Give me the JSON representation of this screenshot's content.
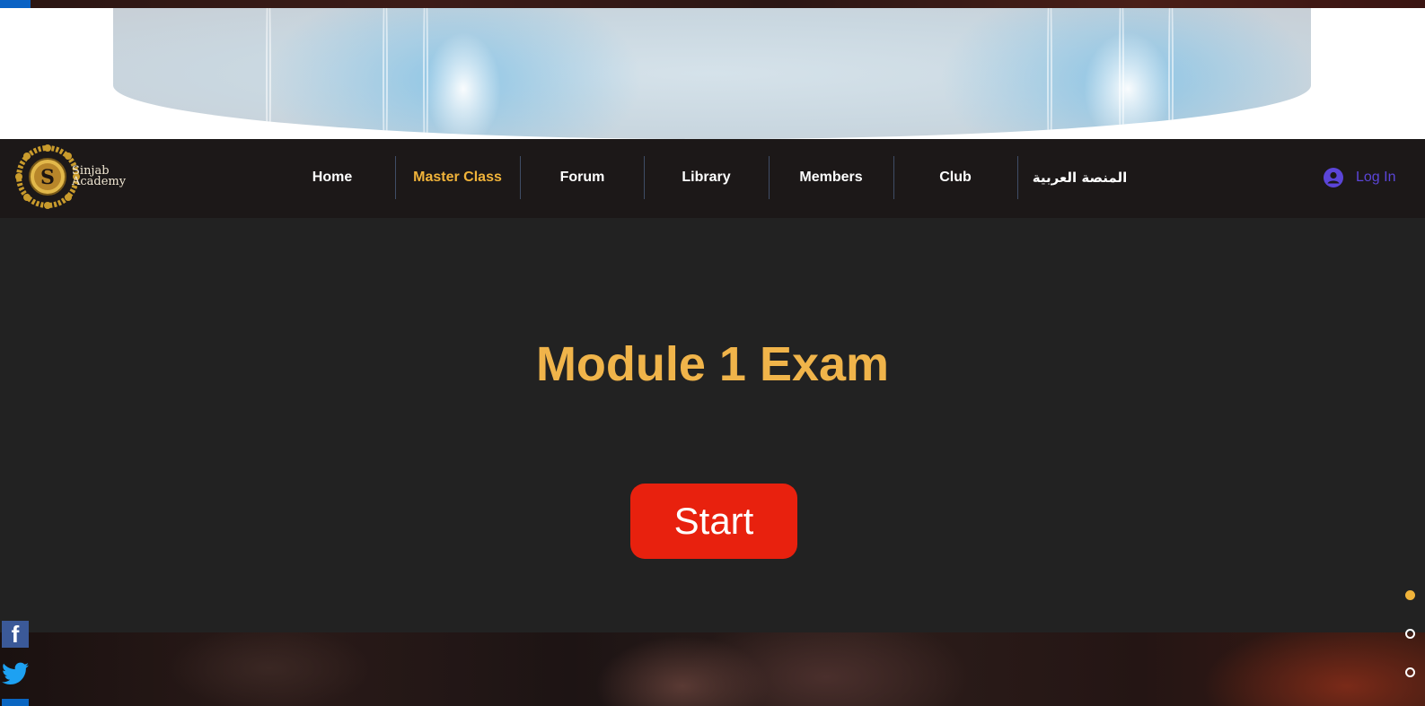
{
  "brand": {
    "logo_letter": "S",
    "name_line1": "Sinjab",
    "name_line2": "Academy"
  },
  "nav": {
    "items": [
      {
        "label": "Home",
        "active": false
      },
      {
        "label": "Master Class",
        "active": true
      },
      {
        "label": "Forum",
        "active": false
      },
      {
        "label": "Library",
        "active": false
      },
      {
        "label": "Members",
        "active": false
      },
      {
        "label": "Club",
        "active": false
      },
      {
        "label": "المنصة العربية",
        "active": false
      }
    ],
    "login_label": "Log In"
  },
  "main": {
    "title": "Module 1 Exam",
    "start_label": "Start"
  },
  "social": {
    "facebook_glyph": "f",
    "icons": [
      "facebook-icon",
      "twitter-icon",
      "linkedin-icon"
    ]
  },
  "page_dots": {
    "count": 3,
    "active_index": 0
  },
  "colors": {
    "accent": "#f0b33a",
    "title": "#f0b44a",
    "start_button": "#e8210e",
    "login": "#5b45d8",
    "navbar_bg": "#1c1818",
    "page_bg": "#222222"
  }
}
